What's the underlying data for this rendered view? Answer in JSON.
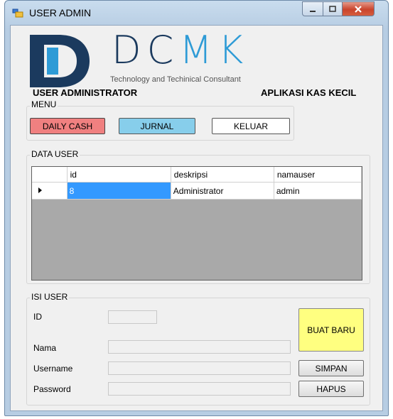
{
  "window": {
    "title": "USER ADMIN",
    "controls": {
      "minimize": "minimize",
      "maximize": "maximize",
      "close": "close"
    }
  },
  "brand": {
    "name_dark": "DC",
    "name_light": "MK",
    "tagline": "Technology and Techinical Consultant",
    "colors": {
      "dark": "#1b3a5e",
      "light": "#2e9bd6"
    }
  },
  "header": {
    "left": "USER ADMINISTRATOR",
    "right": "APLIKASI KAS KECIL"
  },
  "menu": {
    "label": "MENU",
    "buttons": {
      "daily_cash": "DAILY CASH",
      "jurnal": "JURNAL",
      "keluar": "KELUAR"
    }
  },
  "data_user": {
    "label": "DATA USER",
    "columns": [
      "id",
      "deskripsi",
      "namauser"
    ],
    "rows": [
      {
        "id": "8",
        "deskripsi": "Administrator",
        "namauser": "admin",
        "current": true
      }
    ]
  },
  "isi_user": {
    "label": "ISI USER",
    "fields": {
      "id": {
        "label": "ID",
        "value": ""
      },
      "nama": {
        "label": "Nama",
        "value": ""
      },
      "username": {
        "label": "Username",
        "value": ""
      },
      "password": {
        "label": "Password",
        "value": ""
      }
    },
    "buttons": {
      "buat_baru": "BUAT BARU",
      "simpan": "SIMPAN",
      "hapus": "HAPUS"
    }
  }
}
